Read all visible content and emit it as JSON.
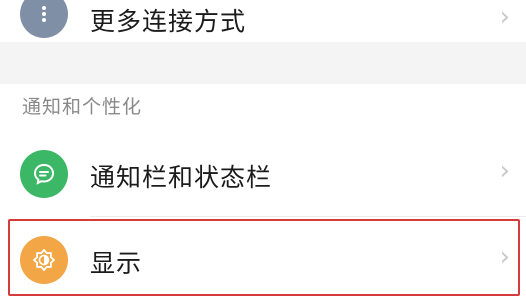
{
  "items": {
    "more_connections": {
      "label": "更多连接方式",
      "icon": "more-dots-icon",
      "icon_color": "#7f8fa6"
    },
    "section_title": "通知和个性化",
    "notification_bar": {
      "label": "通知栏和状态栏",
      "icon": "chat-bubble-icon",
      "icon_color": "#3bb765"
    },
    "display": {
      "label": "显示",
      "icon": "brightness-icon",
      "icon_color": "#f3a646"
    }
  },
  "chevron_glyph": "›",
  "highlight_color": "#d63a3a"
}
